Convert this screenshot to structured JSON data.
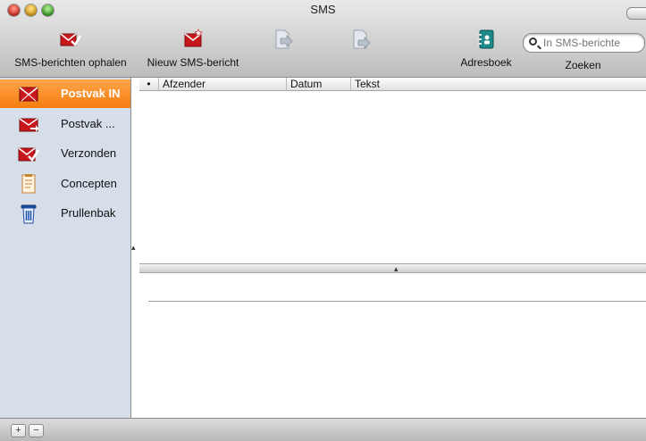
{
  "window": {
    "title": "SMS"
  },
  "toolbar": {
    "fetch_label": "SMS-berichten ophalen",
    "new_label": "Nieuw SMS-bericht",
    "addressbook_label": "Adresboek",
    "search_label": "Zoeken",
    "search_placeholder": "In SMS-berichte"
  },
  "sidebar": {
    "items": [
      {
        "label": "Postvak IN",
        "icon": "inbox-envelope-icon"
      },
      {
        "label": "Postvak ...",
        "icon": "outbox-envelope-icon"
      },
      {
        "label": "Verzonden",
        "icon": "sent-envelope-icon"
      },
      {
        "label": "Concepten",
        "icon": "drafts-note-icon"
      },
      {
        "label": "Prullenbak",
        "icon": "trash-icon"
      }
    ]
  },
  "list": {
    "columns": {
      "dot": "•",
      "from": "Afzender",
      "date": "Datum",
      "text": "Tekst"
    }
  },
  "bottombar": {
    "add": "+",
    "remove": "−"
  },
  "colors": {
    "selected": "#f57d0f",
    "sidebar_bg": "#d6deea",
    "icon_red": "#c8161d"
  }
}
